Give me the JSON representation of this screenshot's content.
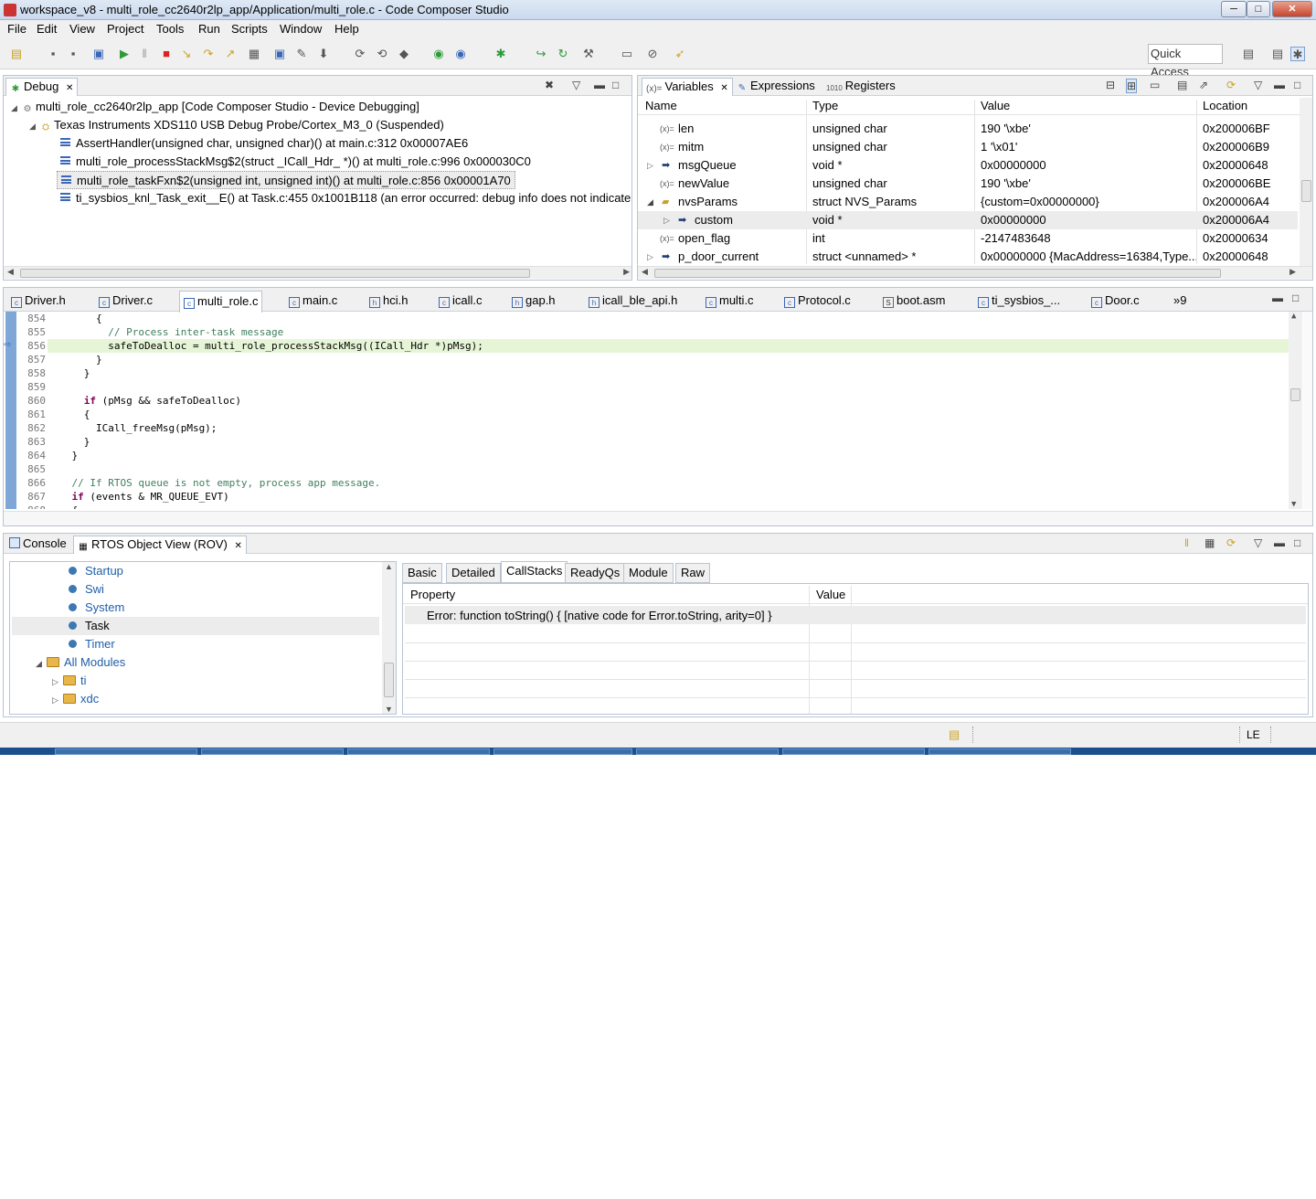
{
  "window": {
    "title": "workspace_v8 - multi_role_cc2640r2lp_app/Application/multi_role.c - Code Composer Studio",
    "minimize": "─",
    "maximize": "□",
    "close": "✕"
  },
  "menu": [
    "File",
    "Edit",
    "View",
    "Project",
    "Tools",
    "Run",
    "Scripts",
    "Window",
    "Help"
  ],
  "toolbar": {
    "quick_access": "Quick Access"
  },
  "debug": {
    "tab_label": "Debug",
    "rows": [
      "multi_role_cc2640r2lp_app [Code Composer Studio - Device Debugging]",
      "Texas Instruments XDS110 USB Debug Probe/Cortex_M3_0 (Suspended)",
      "AssertHandler(unsigned char, unsigned char)() at main.c:312 0x00007AE6",
      "multi_role_processStackMsg$2(struct _ICall_Hdr_ *)() at multi_role.c:996 0x000030C0",
      "multi_role_taskFxn$2(unsigned int, unsigned int)() at multi_role.c:856 0x00001A70",
      "ti_sysbios_knl_Task_exit__E() at Task.c:455 0x1001B118  (an error occurred: debug info does not indicate"
    ]
  },
  "variables": {
    "tabs": [
      "Variables",
      "Expressions",
      "Registers"
    ],
    "columns": [
      "Name",
      "Type",
      "Value",
      "Location"
    ],
    "rows": [
      {
        "name": "len",
        "type": "unsigned char",
        "value": "190 '\\xbe'",
        "location": "0x200006BF"
      },
      {
        "name": "mitm",
        "type": "unsigned char",
        "value": "1 '\\x01'",
        "location": "0x200006B9"
      },
      {
        "name": "msgQueue",
        "type": "void *",
        "value": "0x00000000",
        "location": "0x20000648"
      },
      {
        "name": "newValue",
        "type": "unsigned char",
        "value": "190 '\\xbe'",
        "location": "0x200006BE"
      },
      {
        "name": "nvsParams",
        "type": "struct NVS_Params",
        "value": "{custom=0x00000000}",
        "location": "0x200006A4"
      },
      {
        "name": "custom",
        "type": "void *",
        "value": "0x00000000",
        "location": "0x200006A4"
      },
      {
        "name": "open_flag",
        "type": "int",
        "value": "-2147483648",
        "location": "0x20000634"
      },
      {
        "name": "p_door_current",
        "type": "struct <unnamed> *",
        "value": "0x00000000 {MacAddress=16384,Type...",
        "location": "0x20000648"
      }
    ]
  },
  "editor": {
    "tabs": [
      "Driver.h",
      "Driver.c",
      "multi_role.c",
      "main.c",
      "hci.h",
      "icall.c",
      "gap.h",
      "icall_ble_api.h",
      "multi.c",
      "Protocol.c",
      "boot.asm",
      "ti_sysbios_...",
      "Door.c",
      "»9"
    ],
    "lines": [
      {
        "n": "854",
        "t": "        {"
      },
      {
        "n": "855",
        "t": "          // Process inter-task message"
      },
      {
        "n": "856",
        "t": "          safeToDealloc = multi_role_processStackMsg((ICall_Hdr *)pMsg);"
      },
      {
        "n": "857",
        "t": "        }"
      },
      {
        "n": "858",
        "t": "      }"
      },
      {
        "n": "859",
        "t": ""
      },
      {
        "n": "860",
        "t": "      if (pMsg && safeToDealloc)"
      },
      {
        "n": "861",
        "t": "      {"
      },
      {
        "n": "862",
        "t": "        ICall_freeMsg(pMsg);"
      },
      {
        "n": "863",
        "t": "      }"
      },
      {
        "n": "864",
        "t": "    }"
      },
      {
        "n": "865",
        "t": ""
      },
      {
        "n": "866",
        "t": "    // If RTOS queue is not empty, process app message."
      },
      {
        "n": "867",
        "t": "    if (events & MR_QUEUE_EVT)"
      },
      {
        "n": "868",
        "t": "    {"
      }
    ]
  },
  "bottom": {
    "tabs": [
      "Console",
      "RTOS Object View (ROV)"
    ],
    "tree": [
      {
        "label": "Startup",
        "kind": "leaf"
      },
      {
        "label": "Swi",
        "kind": "leaf"
      },
      {
        "label": "System",
        "kind": "leaf"
      },
      {
        "label": "Task",
        "kind": "leaf"
      },
      {
        "label": "Timer",
        "kind": "leaf"
      },
      {
        "label": "All Modules",
        "kind": "folder-open"
      },
      {
        "label": "ti",
        "kind": "folder"
      },
      {
        "label": "xdc",
        "kind": "folder"
      }
    ],
    "view_tabs": [
      "Basic",
      "Detailed",
      "CallStacks",
      "ReadyQs",
      "Module",
      "Raw"
    ],
    "columns": [
      "Property",
      "Value"
    ],
    "error_row": "Error: function toString() { [native code for Error.toString, arity=0] }"
  },
  "status": {
    "mode": "LE"
  },
  "colors": {
    "accent": "#3a67b8",
    "keyword": "#7f0055",
    "comment": "#3f7f5f",
    "current_line": "#e7f5d7",
    "taskbar": "#1b4f8e"
  }
}
